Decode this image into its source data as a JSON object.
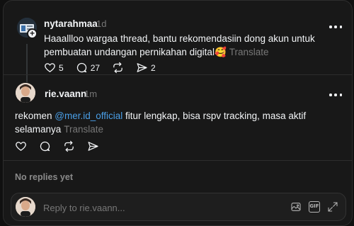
{
  "post": {
    "username": "nytarahmaa",
    "time": "1d",
    "text": "Haaallloo wargaa thread, bantu rekomendasiin dong akun untuk pembuatan undangan pernikahan digital🥰",
    "translate": "Translate",
    "likes": "5",
    "comments": "27",
    "shares": "2",
    "follow_badge": "+"
  },
  "reply": {
    "username": "rie.vaann",
    "time": "1m",
    "text_before": "rekomen ",
    "mention": "@mer.id_official",
    "text_after": " fitur lengkap, bisa rspv tracking, masa aktif selamanya",
    "translate": "Translate"
  },
  "no_replies": "No replies yet",
  "reply_box": {
    "placeholder": "Reply to rie.vaann..."
  },
  "colors": {
    "background": "#181818",
    "text": "#f3f5f7",
    "muted": "#777777",
    "mention": "#4a9fe8"
  },
  "icons": {
    "like": "heart-icon",
    "comment": "comment-icon",
    "repost": "repost-icon",
    "share": "share-icon",
    "more": "more-icon",
    "image": "image-icon",
    "gif": "gif-icon",
    "expand": "expand-icon"
  }
}
